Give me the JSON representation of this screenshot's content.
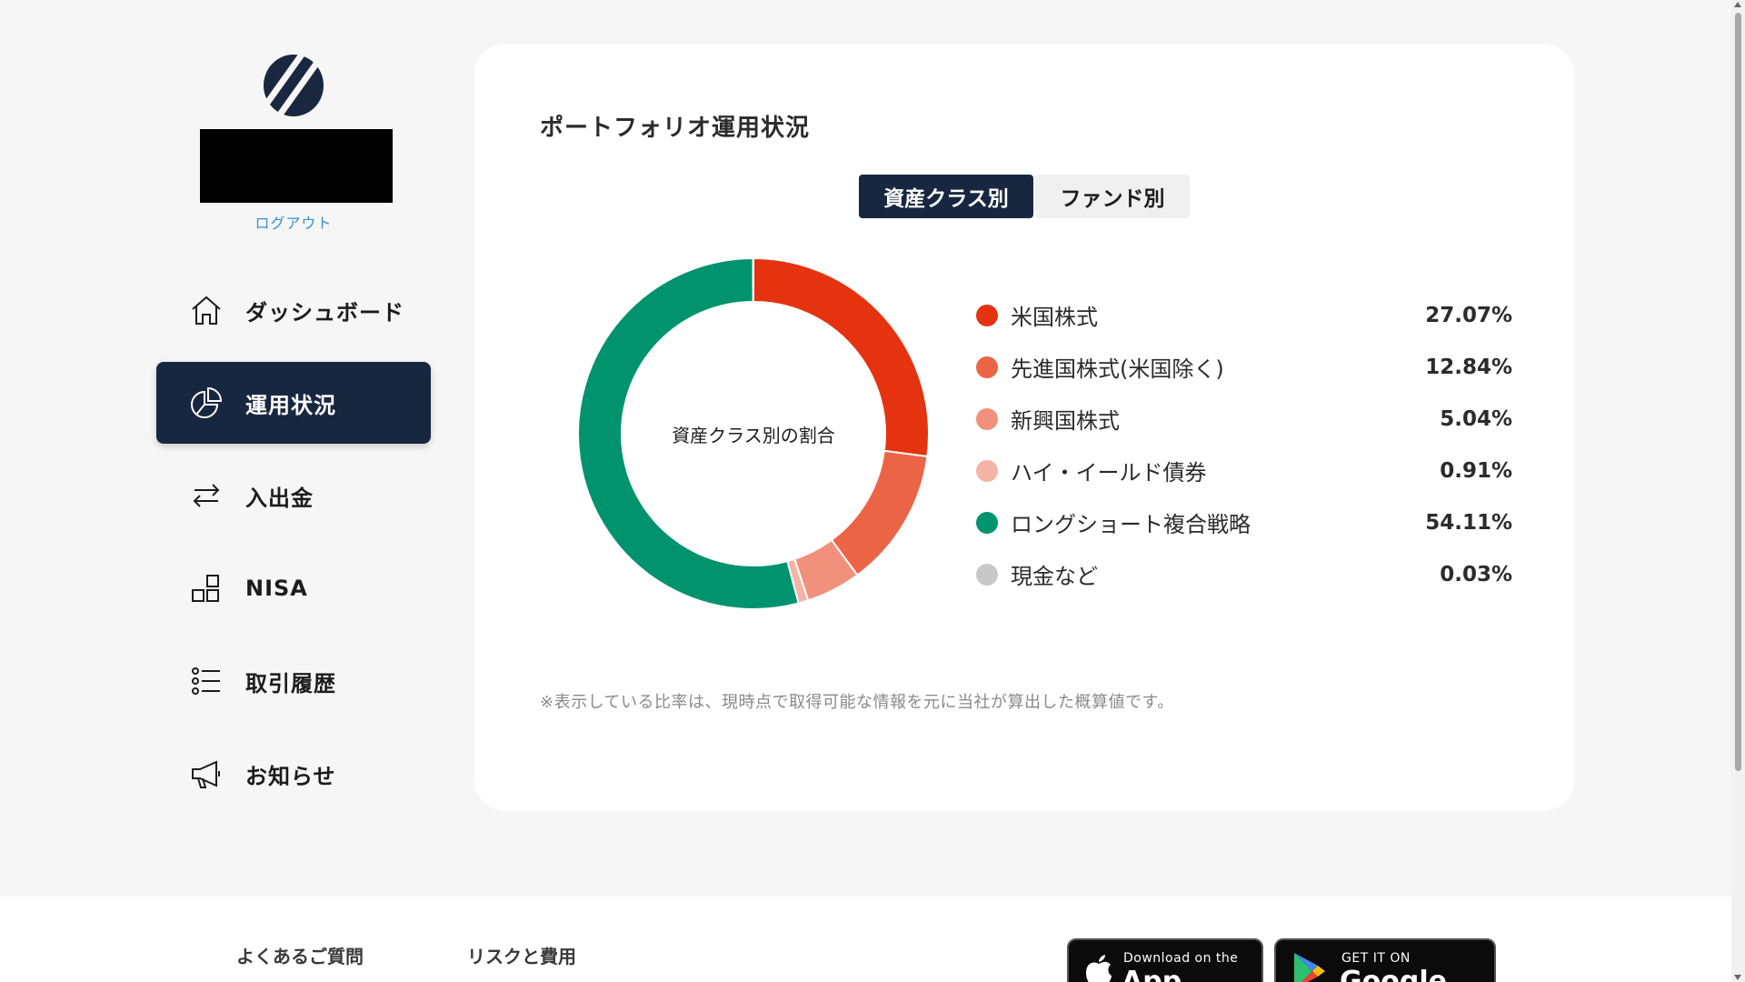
{
  "sidebar": {
    "logout_label": "ログアウト",
    "nav": [
      {
        "label": "ダッシュボード",
        "icon": "home-icon",
        "active": false
      },
      {
        "label": "運用状況",
        "icon": "pie-chart-icon",
        "active": true
      },
      {
        "label": "入出金",
        "icon": "transfer-icon",
        "active": false
      },
      {
        "label": "NISA",
        "icon": "nisa-blocks-icon",
        "active": false
      },
      {
        "label": "取引履歴",
        "icon": "list-icon",
        "active": false
      },
      {
        "label": "お知らせ",
        "icon": "megaphone-icon",
        "active": false
      }
    ]
  },
  "main": {
    "title": "ポートフォリオ運用状況",
    "tabs": [
      {
        "label": "資産クラス別",
        "active": true
      },
      {
        "label": "ファンド別",
        "active": false
      }
    ],
    "donut_center_label": "資産クラス別の割合",
    "note": "※表示している比率は、現時点で取得可能な情報を元に当社が算出した概算値です。"
  },
  "chart_data": {
    "type": "pie",
    "categories": [
      "米国株式",
      "先進国株式(米国除く)",
      "新興国株式",
      "ハイ・イールド債券",
      "ロングショート複合戦略",
      "現金など"
    ],
    "values": [
      27.07,
      12.84,
      5.04,
      0.91,
      54.11,
      0.03
    ],
    "value_labels": [
      "27.07%",
      "12.84%",
      "5.04%",
      "0.91%",
      "54.11%",
      "0.03%"
    ],
    "colors": [
      "#e5330f",
      "#ec6446",
      "#f1907b",
      "#f4b4a6",
      "#00936e",
      "#c8c8c8"
    ],
    "title": "",
    "legend": "right"
  },
  "footer": {
    "links": [
      "よくあるご質問",
      "リスクと費用"
    ],
    "app_store": {
      "small": "Download on the",
      "big": "App Store"
    },
    "google_play": {
      "small": "GET IT ON",
      "big": "Google Play"
    }
  }
}
